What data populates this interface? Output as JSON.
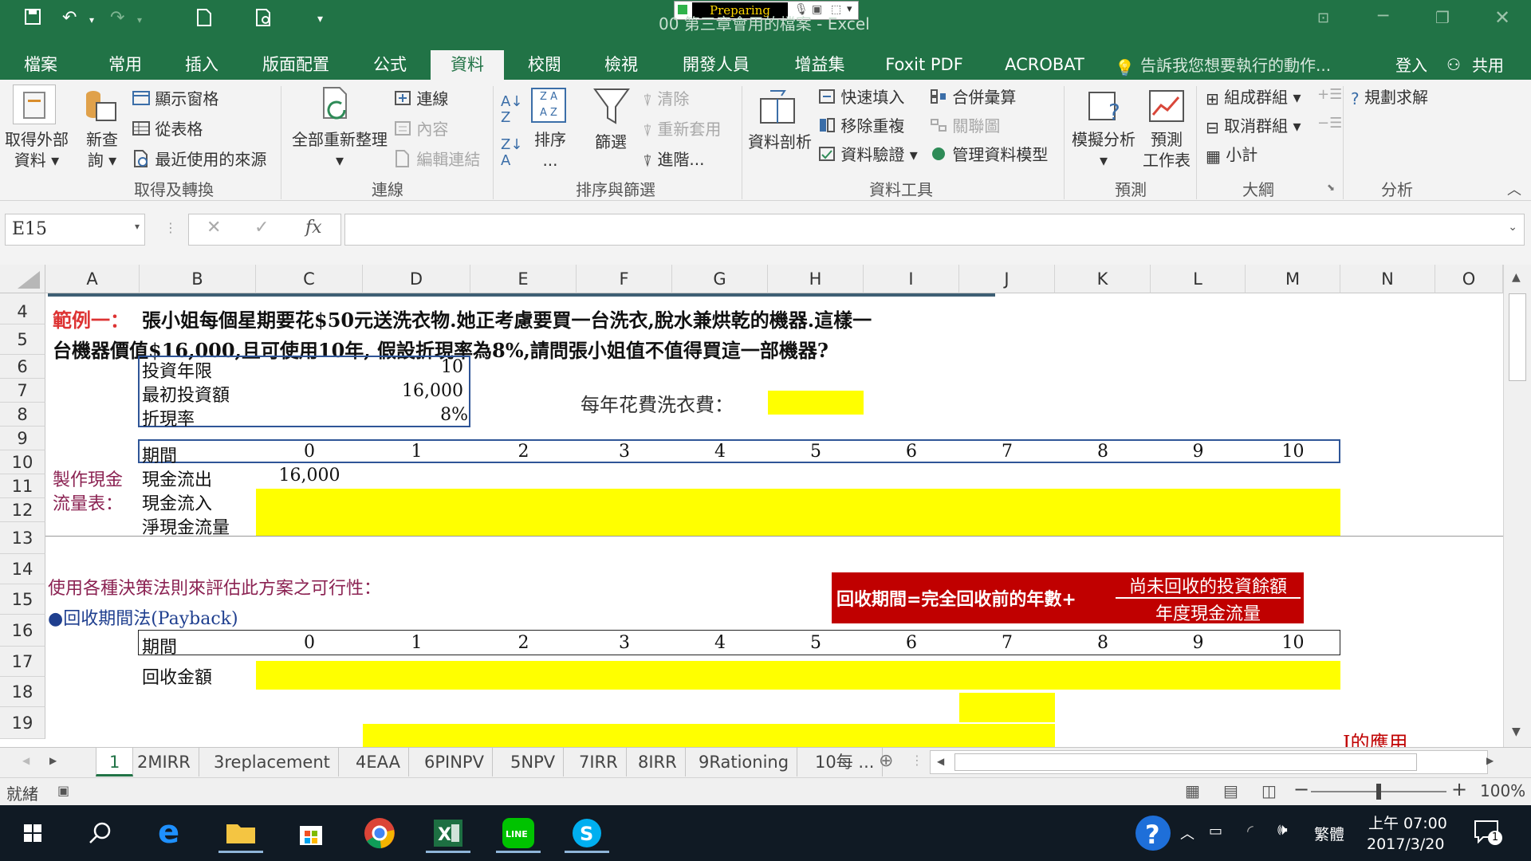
{
  "titlebar": {
    "title": "00 第三章會用的檔案 - Excel",
    "badge": "Preparing"
  },
  "tabs": [
    "檔案",
    "常用",
    "插入",
    "版面配置",
    "公式",
    "資料",
    "校閱",
    "檢視",
    "開發人員",
    "增益集",
    "Foxit PDF",
    "ACROBAT"
  ],
  "tell_me": "告訴我您想要執行的動作...",
  "signin": "登入",
  "share": "共用",
  "ribbon": {
    "get_external": [
      "取得外部",
      "資料"
    ],
    "new_query": [
      "新查",
      "詢"
    ],
    "show_queries": "顯示窗格",
    "from_table": "從表格",
    "recent_sources": "最近使用的來源",
    "refresh_all": "全部重新整理",
    "connections": "連線",
    "properties": "內容",
    "edit_links": "編輯連結",
    "sort": "排序",
    "filter": "篩選",
    "clear": "清除",
    "reapply": "重新套用",
    "advanced": "進階...",
    "text_to_columns": "資料剖析",
    "flash_fill": "快速填入",
    "remove_dup": "移除重複",
    "validation": "資料驗證",
    "consolidate": "合併彙算",
    "relationships": "關聯圖",
    "data_model": "管理資料模型",
    "whatif": "模擬分析",
    "forecast": [
      "預測",
      "工作表"
    ],
    "group": "組成群組",
    "ungroup": "取消群組",
    "subtotal": "小計",
    "solver": "規劃求解",
    "groups": [
      "取得及轉換",
      "連線",
      "排序與篩選",
      "資料工具",
      "預測",
      "大綱",
      "分析"
    ]
  },
  "namebox": "E15",
  "columns": [
    "A",
    "B",
    "C",
    "D",
    "E",
    "F",
    "G",
    "H",
    "I",
    "J",
    "K",
    "L",
    "M",
    "N",
    "O"
  ],
  "rows": [
    "4",
    "5",
    "6",
    "7",
    "8",
    "9",
    "10",
    "11",
    "12",
    "13",
    "14",
    "15",
    "16",
    "17",
    "18",
    "19"
  ],
  "sheet": {
    "ex_label": "範例一：",
    "ex_line1": "張小姐每個星期要花$50元送洗衣物.她正考慮要買一台洗衣,脫水兼烘乾的機器.這樣一",
    "ex_line2": "台機器價值$16,000,且可使用10年, 假設折現率為8%,請問張小姐值不值得買這一部機器?",
    "inv_years_lbl": "投資年限",
    "inv_years": "10",
    "init_inv_lbl": "最初投資額",
    "init_inv": "16,000",
    "rate_lbl": "折現率",
    "rate": "8%",
    "laundry_lbl": "每年花費洗衣費：",
    "period_lbl": "期間",
    "periods": [
      "0",
      "1",
      "2",
      "3",
      "4",
      "5",
      "6",
      "7",
      "8",
      "9",
      "10"
    ],
    "make_cf1": "製作現金",
    "make_cf2": "流量表：",
    "outflow_lbl": "現金流出",
    "outflow_0": "16,000",
    "inflow_lbl": "現金流入",
    "net_lbl": "淨現金流量",
    "use_methods": "使用各種決策法則來評估此方案之可行性：",
    "payback": "●回收期間法(Payback)",
    "formula_left": "回收期間=完全回收前的年數+",
    "formula_num": "尚未回收的投資餘額",
    "formula_den": "年度現金流量",
    "recovered_lbl": "回收金額",
    "partial": "I的應用"
  },
  "sheettabs": [
    "1",
    "2MIRR",
    "3replacement",
    "4EAA",
    "6PINPV",
    "5NPV",
    "7IRR",
    "8IRR",
    "9Rationing",
    "10每 ..."
  ],
  "status": {
    "ready": "就緒",
    "zoom": "100%"
  },
  "clock": {
    "time": "上午 07:00",
    "date": "2017/3/20",
    "ime": "繁體",
    "notif": "1"
  }
}
